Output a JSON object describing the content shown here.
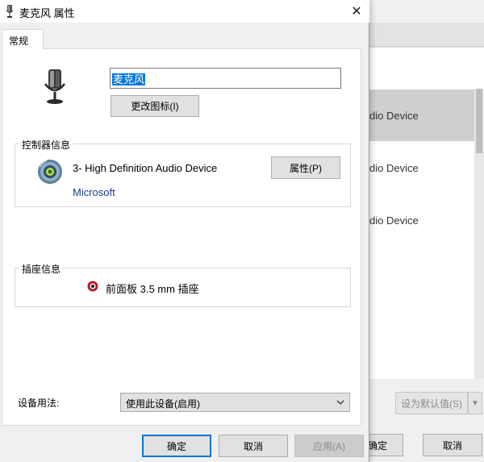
{
  "dialog": {
    "title": "麦克风 属性",
    "close_glyph": "✕",
    "tab_general": "常规",
    "device_name_value": "麦克风",
    "change_icon_label": "更改图标(I)",
    "controller_group_label": "控制器信息",
    "controller_device": "3- High Definition Audio Device",
    "controller_vendor": "Microsoft",
    "properties_label": "属性(P)",
    "jack_group_label": "插座信息",
    "jack_text": "前面板 3.5 mm 插座",
    "usage_label": "设备用法:",
    "usage_value": "使用此设备(启用)",
    "ok_label": "确定",
    "cancel_label": "取消",
    "apply_label": "应用(A)"
  },
  "background_window": {
    "rows": [
      "dio Device",
      "dio Device",
      "dio Device"
    ],
    "set_default_label": "设为默认值(S)",
    "dropdown_glyph": "▼",
    "ok_label": "确定",
    "cancel_label": "取消"
  },
  "colors": {
    "accent": "#0078d7",
    "jack_color": "#c01830",
    "vendor_text": "#1a3c8f"
  },
  "icons": {
    "title": "microphone-icon",
    "device": "microphone-icon",
    "controller": "speaker-disc-icon",
    "jack": "audio-jack-icon",
    "close": "close-icon",
    "dropdown": "chevron-down-icon"
  }
}
